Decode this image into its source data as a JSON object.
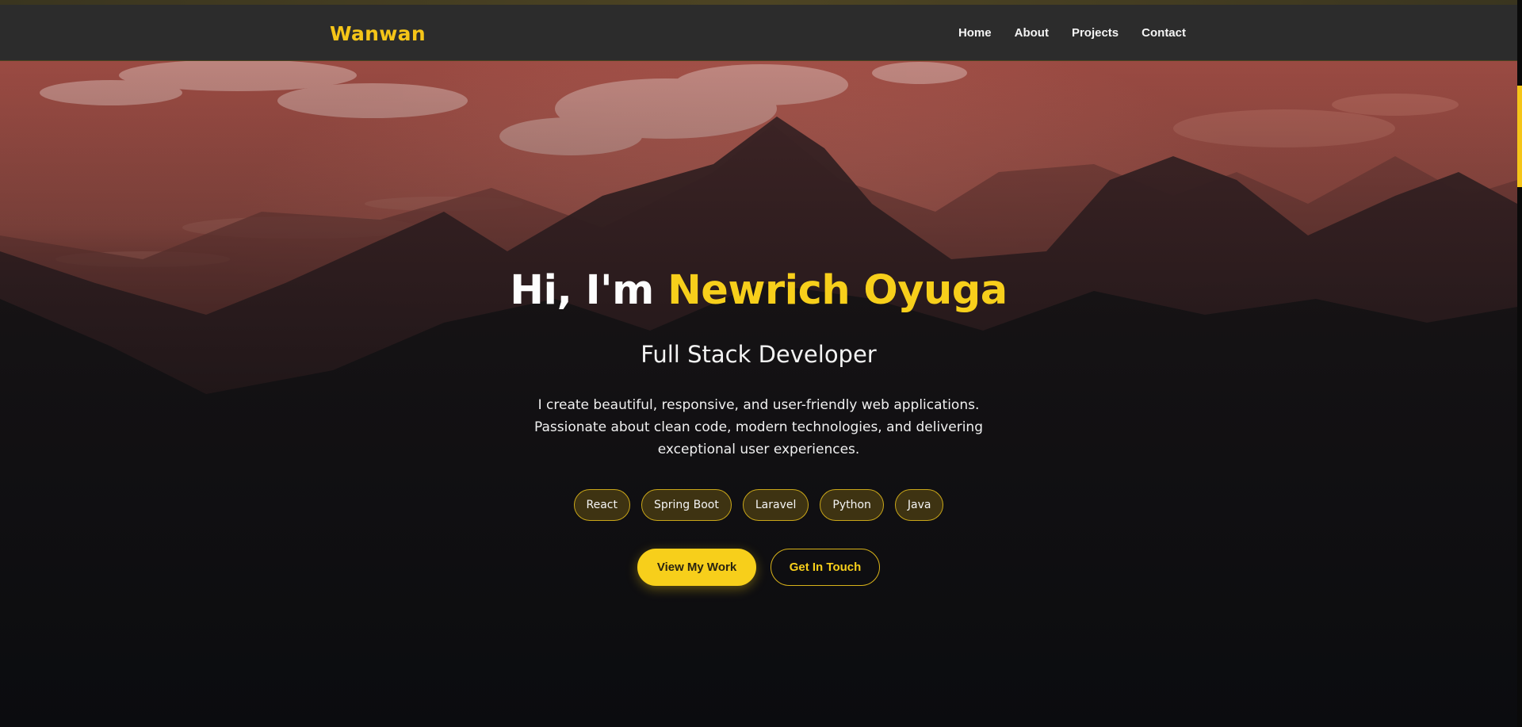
{
  "brand": {
    "name": "Wanwan"
  },
  "nav": {
    "items": [
      {
        "label": "Home"
      },
      {
        "label": "About"
      },
      {
        "label": "Projects"
      },
      {
        "label": "Contact"
      }
    ]
  },
  "hero": {
    "greeting": "Hi, I'm ",
    "name": "Newrich Oyuga",
    "subtitle": "Full Stack Developer",
    "description": "I create beautiful, responsive, and user-friendly web applications. Passionate about clean code, modern technologies, and delivering exceptional user experiences.",
    "tags": [
      {
        "label": "React"
      },
      {
        "label": "Spring Boot"
      },
      {
        "label": "Laravel"
      },
      {
        "label": "Python"
      },
      {
        "label": "Java"
      }
    ],
    "primary_button": "View My Work",
    "secondary_button": "Get In Touch"
  },
  "colors": {
    "accent": "#f7cf1b",
    "navbar": "#2c2c2c",
    "hero_dark": "#0c0d10"
  },
  "scroll": {
    "position_fraction": 0.0
  }
}
